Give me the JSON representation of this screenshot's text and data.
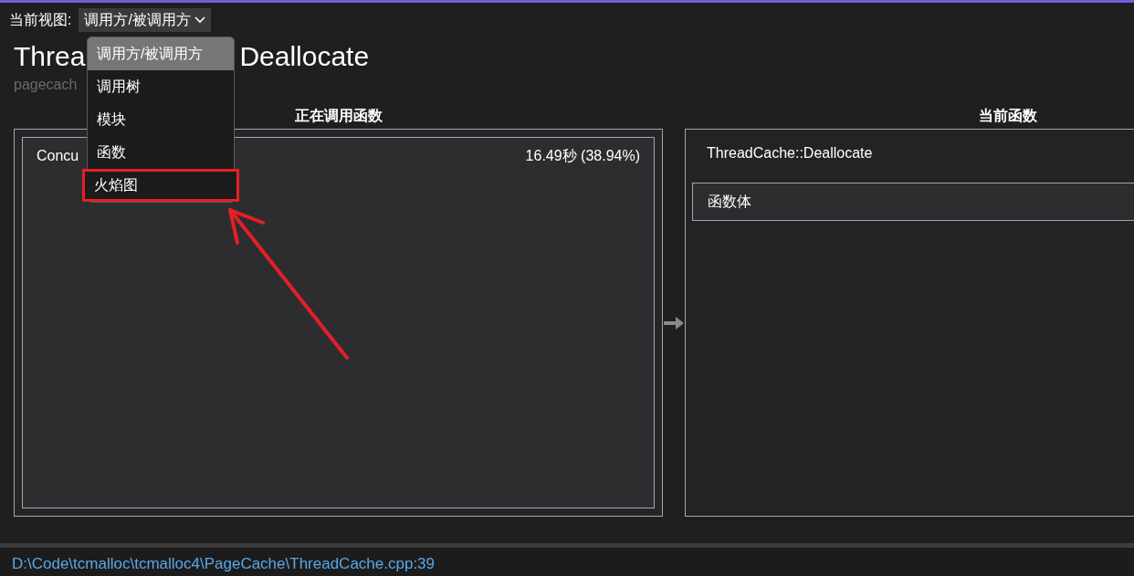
{
  "view_selector": {
    "label": "当前视图:",
    "value": "调用方/被调用方"
  },
  "view_menu": {
    "items": [
      {
        "label": "调用方/被调用方",
        "selected": true,
        "highlighted": false
      },
      {
        "label": "调用树",
        "selected": false,
        "highlighted": false
      },
      {
        "label": "模块",
        "selected": false,
        "highlighted": false
      },
      {
        "label": "函数",
        "selected": false,
        "highlighted": false
      },
      {
        "label": "火焰图",
        "selected": false,
        "highlighted": true
      }
    ]
  },
  "title": {
    "left": "Threa",
    "right": "Deallocate"
  },
  "subtitle": "pagecach",
  "calling_functions": {
    "heading": "正在调用函数",
    "items": [
      {
        "name": "Concu",
        "time": "16.49秒 (38.94%)"
      }
    ]
  },
  "current_function": {
    "heading": "当前函数",
    "name": "ThreadCache::Deallocate",
    "items": [
      {
        "label": "函数体"
      }
    ]
  },
  "status_bar": {
    "path": "D:\\Code\\tcmalloc\\tcmalloc4\\PageCache\\ThreadCache.cpp:39"
  }
}
